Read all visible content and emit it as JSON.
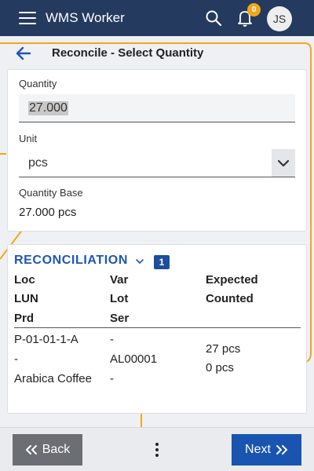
{
  "app": {
    "title": "WMS Worker",
    "user_initials": "JS",
    "notification_count": "0"
  },
  "colors": {
    "topbar": "#243a5e",
    "accent": "#1954b0",
    "badge": "#f2a71b",
    "back_button": "#6b6f73",
    "decor_line": "#f2a71b"
  },
  "icons": {
    "menu": "hamburger-icon",
    "search": "search-icon",
    "notifications": "bell-icon",
    "back": "arrow-left-icon",
    "dropdown": "chevron-down-icon",
    "more": "kebab-icon"
  },
  "page": {
    "title": "Reconcile - Select Quantity"
  },
  "form": {
    "quantity_label": "Quantity",
    "quantity_value": "27.000",
    "unit_label": "Unit",
    "unit_value": "pcs",
    "quantity_base_label": "Quantity Base",
    "quantity_base_value": "27.000 pcs"
  },
  "reconciliation": {
    "title": "RECONCILIATION",
    "count": "1",
    "headers": {
      "col1": [
        "Loc",
        "LUN",
        "Prd"
      ],
      "col2": [
        "Var",
        "Lot",
        "Ser"
      ],
      "col3": [
        "Expected",
        "Counted"
      ]
    },
    "rows": [
      {
        "col1": [
          "P-01-01-1-A",
          "-",
          "Arabica Coffee"
        ],
        "col2": [
          "-",
          "AL00001",
          "-"
        ],
        "col3": [
          "27 pcs",
          "0 pcs"
        ]
      }
    ]
  },
  "footer": {
    "back_label": "Back",
    "next_label": "Next"
  }
}
